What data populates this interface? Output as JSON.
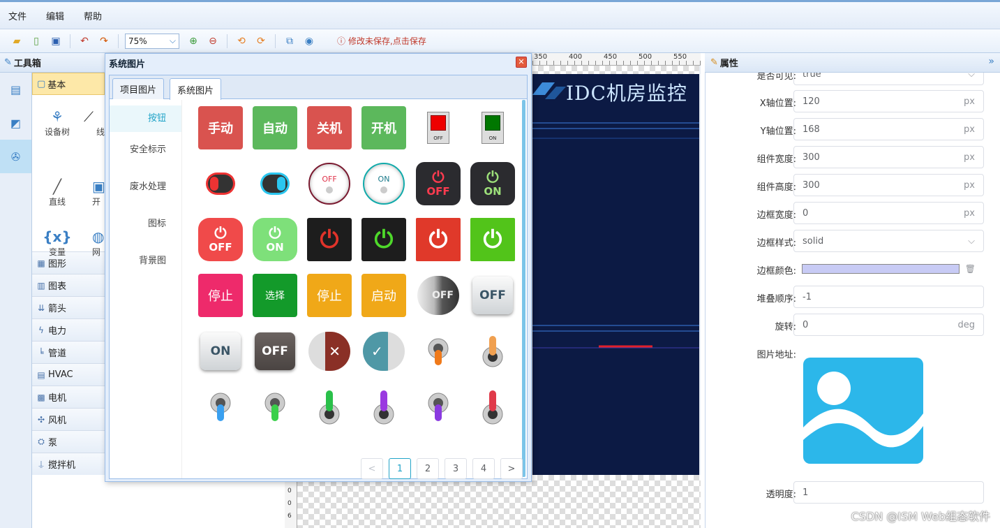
{
  "menu": {
    "items": [
      "文件",
      "编辑",
      "帮助"
    ]
  },
  "toolbar": {
    "zoom": "75%",
    "unsaved_notice": "修改未保存,点击保存"
  },
  "toolbox": {
    "title": "工具箱",
    "basic_label": "基本",
    "basic_items": [
      "设备树",
      "线",
      "直线",
      "开",
      "变量",
      "网"
    ],
    "categories": [
      "图形",
      "图表",
      "箭头",
      "电力",
      "管道",
      "HVAC",
      "电机",
      "风机",
      "泵",
      "搅拌机"
    ]
  },
  "dialog": {
    "title": "系统图片",
    "tabs": [
      "项目图片",
      "系统图片"
    ],
    "categories": [
      "按钮",
      "安全标示",
      "废水处理",
      "图标",
      "背景图"
    ],
    "buttons": {
      "manual": "手动",
      "auto": "自动",
      "close": "关机",
      "open": "开机",
      "stop": "停止",
      "select": "选择",
      "start": "启动"
    },
    "switch_labels": {
      "off": "OFF",
      "on": "ON"
    },
    "pagination": {
      "prev": "<",
      "pages": [
        "1",
        "2",
        "3",
        "4"
      ],
      "next": ">",
      "current": "1"
    }
  },
  "canvas": {
    "title": "IDC机房监控",
    "ruler_ticks": [
      "350",
      "400",
      "450",
      "500",
      "550"
    ],
    "side_ticks": [
      "6",
      "0",
      "0",
      "6"
    ]
  },
  "properties": {
    "title": "属性",
    "partial_top_label": "是否可见:",
    "partial_top_value": "true",
    "rows": [
      {
        "label": "X轴位置:",
        "value": "120",
        "unit": "px"
      },
      {
        "label": "Y轴位置:",
        "value": "168",
        "unit": "px"
      },
      {
        "label": "组件宽度:",
        "value": "300",
        "unit": "px"
      },
      {
        "label": "组件高度:",
        "value": "300",
        "unit": "px"
      },
      {
        "label": "边框宽度:",
        "value": "0",
        "unit": "px"
      },
      {
        "label": "边框样式:",
        "value": "solid",
        "unit": "⌵"
      },
      {
        "label": "边框颜色:",
        "value": "",
        "unit": "🗑"
      },
      {
        "label": "堆叠顺序:",
        "value": "-1",
        "unit": ""
      },
      {
        "label": "旋转:",
        "value": "0",
        "unit": "deg"
      }
    ],
    "image_label": "图片地址:",
    "opacity_label": "透明度:",
    "opacity_value": "1",
    "border_color": "#c8cbf5"
  },
  "watermark": "CSDN @ISM Web组态软件",
  "colors": {
    "accent": "#22a4c8",
    "danger": "#e35b3c",
    "green": "#5cb85c",
    "dark_screen": "#0c1a44"
  }
}
